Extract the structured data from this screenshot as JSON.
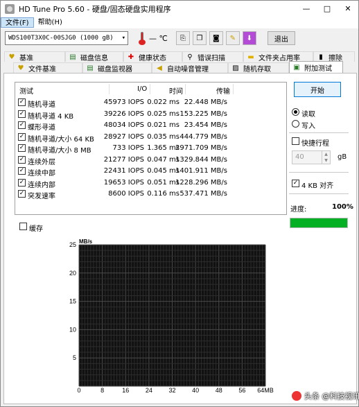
{
  "window": {
    "title": "HD Tune Pro 5.60 - 硬盘/固态硬盘实用程序",
    "controls": [
      "—",
      "□",
      "✕"
    ]
  },
  "menu": [
    "文件(F)",
    "帮助(H)"
  ],
  "toolbar": {
    "drive": "WDS100T3X0C-00SJG0 (1000 gB)",
    "temperature": "— ℃",
    "exit_label": "退出",
    "icons": [
      "copy-icon",
      "copy-all-icon",
      "screenshot-icon",
      "options-icon",
      "save-icon"
    ]
  },
  "tabs_row1": [
    {
      "label": "基准",
      "icon": "benchmark-icon",
      "glyph": "♥"
    },
    {
      "label": "磁盘信息",
      "icon": "disk-info-icon",
      "glyph": "▤"
    },
    {
      "label": "健康状态",
      "icon": "health-icon",
      "glyph": "✚"
    },
    {
      "label": "错误扫描",
      "icon": "error-scan-icon",
      "glyph": "⚲"
    },
    {
      "label": "文件夹占用率",
      "icon": "folder-usage-icon",
      "glyph": "▬"
    },
    {
      "label": "擦除",
      "icon": "erase-icon",
      "glyph": "▮"
    }
  ],
  "tabs_row2": [
    {
      "label": "文件基准",
      "icon": "file-benchmark-icon",
      "glyph": "♥"
    },
    {
      "label": "磁盘监视器",
      "icon": "disk-monitor-icon",
      "glyph": "▤"
    },
    {
      "label": "自动噪音管理",
      "icon": "aam-icon",
      "glyph": "◀"
    },
    {
      "label": "随机存取",
      "icon": "random-access-icon",
      "glyph": "▨"
    },
    {
      "label": "附加测试",
      "icon": "extra-tests-icon",
      "glyph": "▣",
      "active": true
    }
  ],
  "results": {
    "headers": {
      "test": "测试",
      "io": "I/O",
      "time": "时间",
      "transfer": "传输"
    },
    "rows": [
      {
        "checked": true,
        "name": "随机寻道",
        "io": "45973 IOPS",
        "time": "0.022 ms",
        "transfer": "22.448 MB/s"
      },
      {
        "checked": true,
        "name": "随机寻道 4 KB",
        "io": "39226 IOPS",
        "time": "0.025 ms",
        "transfer": "153.225 MB/s"
      },
      {
        "checked": true,
        "name": "蝶形寻道",
        "io": "48034 IOPS",
        "time": "0.021 ms",
        "transfer": "23.454 MB/s"
      },
      {
        "checked": true,
        "name": "随机寻道/大小 64 KB",
        "io": "28927 IOPS",
        "time": "0.035 ms",
        "transfer": "444.779 MB/s"
      },
      {
        "checked": true,
        "name": "随机寻道/大小 8 MB",
        "io": "733 IOPS",
        "time": "1.365 ms",
        "transfer": "2971.709 MB/s"
      },
      {
        "checked": true,
        "name": "连续外层",
        "io": "21277 IOPS",
        "time": "0.047 ms",
        "transfer": "1329.844 MB/s"
      },
      {
        "checked": true,
        "name": "连续中部",
        "io": "22431 IOPS",
        "time": "0.045 ms",
        "transfer": "1401.911 MB/s"
      },
      {
        "checked": true,
        "name": "连续内部",
        "io": "19653 IOPS",
        "time": "0.051 ms",
        "transfer": "1228.296 MB/s"
      },
      {
        "checked": true,
        "name": "突发速率",
        "io": "8600 IOPS",
        "time": "0.116 ms",
        "transfer": "537.471 MB/s"
      }
    ]
  },
  "controls": {
    "start_label": "开始",
    "read_label": "读取",
    "write_label": "写入",
    "mode_selected": "读取",
    "quick_label": "快捷行程",
    "quick_checked": false,
    "quick_value": "40",
    "quick_unit": "gB",
    "align_label": "4 KB 对齐",
    "align_checked": true,
    "progress_label": "进度:",
    "progress_text": "100%",
    "progress_value": 100,
    "cache_label": "缓存",
    "cache_checked": false
  },
  "chart_data": {
    "type": "line",
    "ylabel": "MB/s",
    "xlabel": "",
    "x_ticks": [
      "0",
      "8",
      "16",
      "24",
      "32",
      "40",
      "48",
      "56",
      "64MB"
    ],
    "y_ticks": [
      "25",
      "20",
      "15",
      "10",
      "5"
    ],
    "ylim": [
      0,
      25
    ],
    "xlim": [
      0,
      64
    ],
    "grid": true,
    "series": []
  },
  "watermark": "头条 @科技视讯"
}
